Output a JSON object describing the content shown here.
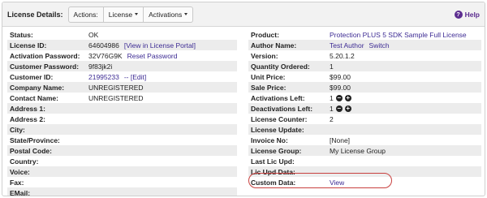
{
  "header": {
    "title": "License Details:",
    "actions_label": "Actions:",
    "license_menu": "License",
    "activations_menu": "Activations",
    "help_label": "Help"
  },
  "left": [
    {
      "label": "Status:",
      "value": "OK"
    },
    {
      "label": "License ID:",
      "value": "64604986",
      "link": "[View in License Portal]"
    },
    {
      "label": "Activation Password:",
      "value": "32V76G9K",
      "link": "Reset Password"
    },
    {
      "label": "Customer Password:",
      "value": "9f83jk2i"
    },
    {
      "label": "Customer ID:",
      "value_link": "21995233",
      "suffix": "-- [Edit]"
    },
    {
      "label": "Company Name:",
      "value": "UNREGISTERED"
    },
    {
      "label": "Contact Name:",
      "value": "UNREGISTERED"
    },
    {
      "label": "Address 1:",
      "value": ""
    },
    {
      "label": "Address 2:",
      "value": ""
    },
    {
      "label": "City:",
      "value": ""
    },
    {
      "label": "State/Province:",
      "value": ""
    },
    {
      "label": "Postal Code:",
      "value": ""
    },
    {
      "label": "Country:",
      "value": ""
    },
    {
      "label": "Voice:",
      "value": ""
    },
    {
      "label": "Fax:",
      "value": ""
    },
    {
      "label": "EMail:",
      "value": ""
    }
  ],
  "right": {
    "product": {
      "label": "Product:",
      "value": "Protection PLUS 5 SDK Sample Full License"
    },
    "author": {
      "label": "Author Name:",
      "value": "Test Author",
      "link": "Switch"
    },
    "version": {
      "label": "Version:",
      "value": "5.20.1.2"
    },
    "quantity": {
      "label": "Quantity Ordered:",
      "value": "1"
    },
    "unit_price": {
      "label": "Unit Price:",
      "value": "$99.00"
    },
    "sale_price": {
      "label": "Sale Price:",
      "value": "$99.00"
    },
    "activations_left": {
      "label": "Activations Left:",
      "value": "1"
    },
    "deactivations_left": {
      "label": "Deactivations Left:",
      "value": "1"
    },
    "license_counter": {
      "label": "License Counter:",
      "value": "2"
    },
    "license_update": {
      "label": "License Update:",
      "value": ""
    },
    "invoice": {
      "label": "Invoice No:",
      "value": "[None]"
    },
    "license_group": {
      "label": "License Group:",
      "value": "My License Group"
    },
    "last_lic_upd": {
      "label": "Last Lic Upd:",
      "value": ""
    },
    "lic_upd_data": {
      "label": "Lic Upd Data:",
      "value": ""
    },
    "custom_data": {
      "label": "Custom Data:",
      "value": "View"
    }
  },
  "stepper": {
    "minus": "−",
    "plus": "+"
  },
  "colors": {
    "link": "#3c2a93",
    "highlight": "#c8413f",
    "stripe": "#ececec"
  }
}
